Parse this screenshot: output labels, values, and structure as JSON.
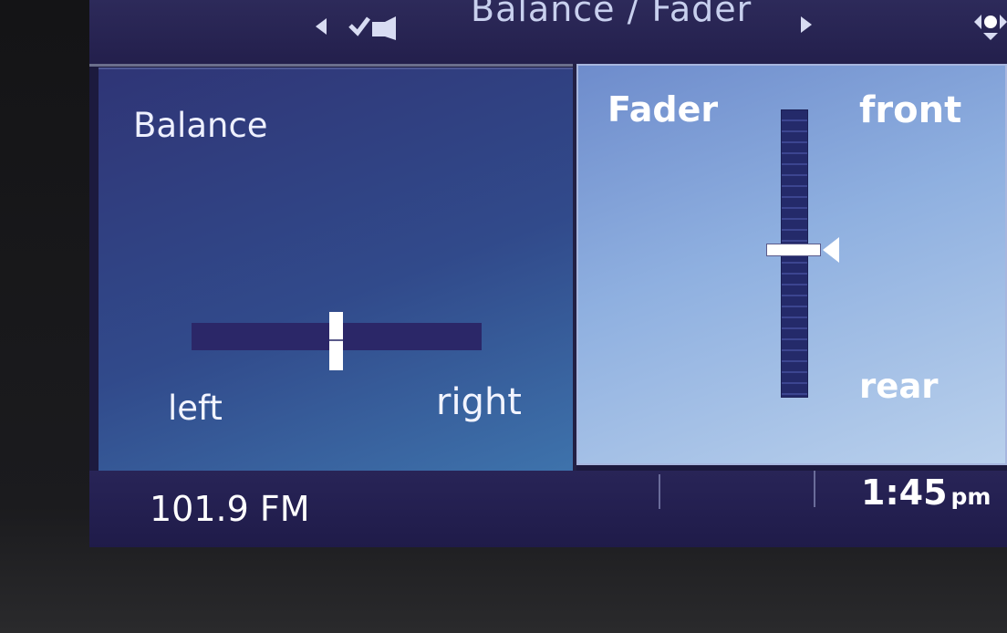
{
  "header": {
    "title": "Balance / Fader",
    "icons": [
      "arrow-left-icon",
      "check-icon",
      "arrow-right-icon",
      "joystick-icon"
    ]
  },
  "balance": {
    "label": "Balance",
    "left_label": "left",
    "right_label": "right",
    "position": 0.5
  },
  "fader": {
    "label": "Fader",
    "front_label": "front",
    "rear_label": "rear",
    "position_from_top": 0.49
  },
  "status": {
    "station": "101.9 FM",
    "time": "1:45",
    "ampm": "pm"
  },
  "colors": {
    "accent": "#ffffff",
    "track": "#2b2768",
    "fader_panel": "#8fb0e0"
  }
}
